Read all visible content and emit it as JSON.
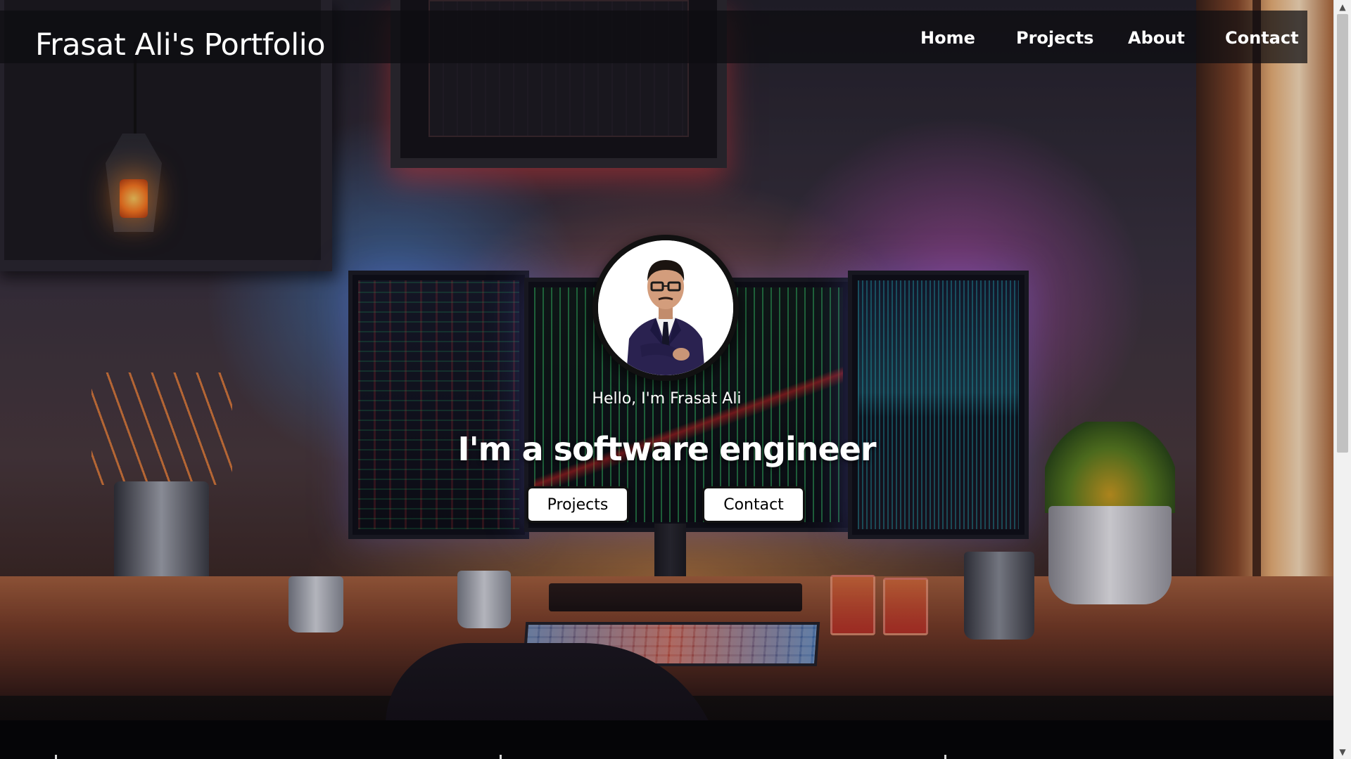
{
  "header": {
    "brand": "Frasat Ali's Portfolio",
    "nav": [
      {
        "label": "Home"
      },
      {
        "label": "Projects"
      },
      {
        "label": "About"
      },
      {
        "label": "Contact"
      }
    ]
  },
  "hero": {
    "greeting": "Hello, I'm Frasat Ali",
    "headline": "I'm a software engineer",
    "buttons": {
      "projects": "Projects",
      "contact": "Contact"
    }
  },
  "scrollbar": {
    "up_icon": "chevron-up-icon",
    "down_icon": "chevron-down-icon",
    "up_glyph": "▲",
    "down_glyph": "▼",
    "thumb_fraction": 0.6
  },
  "colors": {
    "nav_bg": "#0c0c10",
    "button_bg": "#ffffff",
    "button_border": "#111111",
    "text": "#ffffff"
  }
}
